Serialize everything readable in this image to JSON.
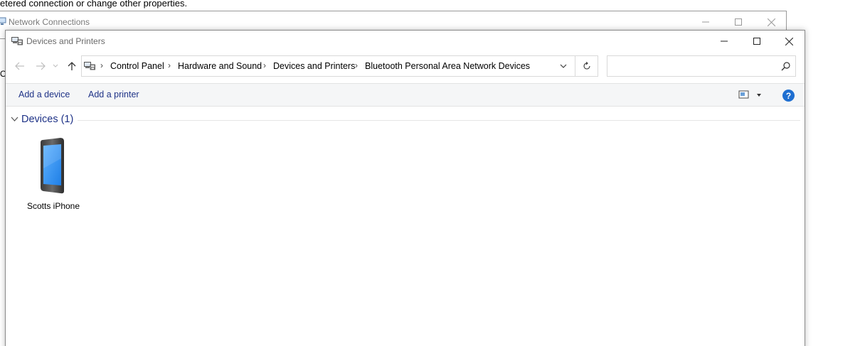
{
  "background": {
    "top_text": "etered connection or change other properties.",
    "side_letter": "O",
    "back_window_title": "Network Connections"
  },
  "window": {
    "title": "Devices and Printers",
    "title_icon": "devices-printers-icon",
    "controls": [
      "minimize",
      "maximize",
      "close"
    ]
  },
  "nav": {
    "back_icon": "arrow-left-icon",
    "forward_icon": "arrow-right-icon",
    "recent_icon": "chevron-down-icon",
    "up_icon": "arrow-up-icon"
  },
  "address": {
    "breadcrumbs": [
      "Control Panel",
      "Hardware and Sound",
      "Devices and Printers",
      "Bluetooth Personal Area Network Devices"
    ],
    "refresh_icon": "refresh-icon"
  },
  "search": {
    "placeholder": ""
  },
  "commands": {
    "add_device": "Add a device",
    "add_printer": "Add a printer",
    "help": "?"
  },
  "content": {
    "group_label": "Devices (1)",
    "devices": [
      {
        "name": "Scotts iPhone",
        "icon": "smartphone-icon"
      }
    ]
  },
  "colors": {
    "link_blue": "#1e3287",
    "help_blue": "#1f6fd1",
    "phone_screen": "#2e8ef0"
  }
}
